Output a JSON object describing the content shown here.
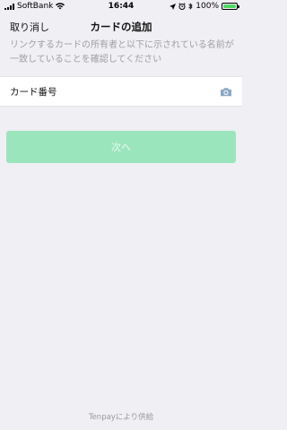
{
  "status_bar": {
    "carrier": "SoftBank",
    "time": "16:44",
    "battery_percent": "100%",
    "battery_level": 1.0,
    "icons": [
      "signal-icon",
      "wifi-icon",
      "location-icon",
      "alarm-icon",
      "bluetooth-icon",
      "battery-icon"
    ]
  },
  "nav": {
    "cancel_label": "取り消し",
    "title": "カードの追加"
  },
  "hint_text": "リンクするカードの所有者と以下に示されている名前が一致していることを確認してください",
  "card_field": {
    "label": "カード番号",
    "icon": "camera-icon"
  },
  "next_button": {
    "label": "次へ",
    "enabled": false,
    "color": "#9be5bd"
  },
  "footer": {
    "text": "Tenpayにより供給"
  }
}
